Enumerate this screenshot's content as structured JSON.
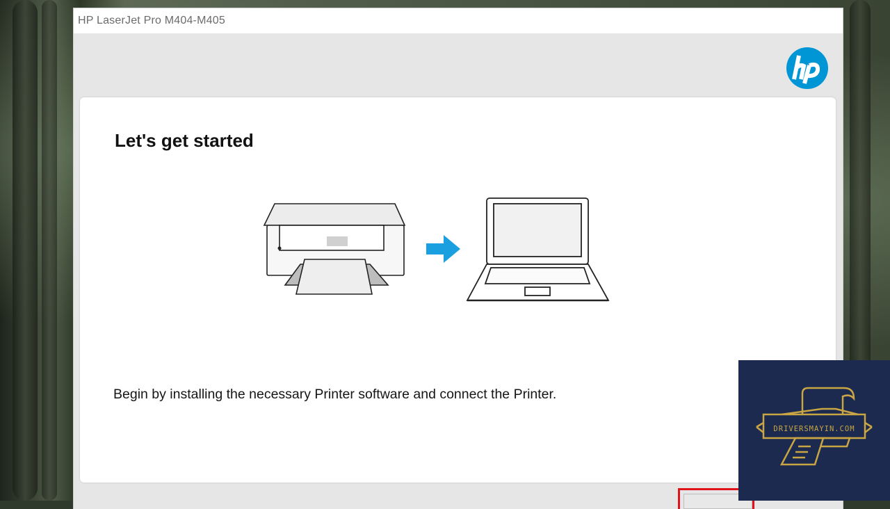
{
  "window": {
    "title": "HP LaserJet Pro M404-M405"
  },
  "brand": {
    "logo_icon": "hp-logo-icon",
    "accent_color": "#0096d6"
  },
  "content": {
    "heading": "Let's get started",
    "description": "Begin by installing the necessary Printer software and connect the Printer.",
    "illustration_icons": [
      "printer-icon",
      "arrow-right-icon",
      "laptop-icon"
    ]
  },
  "watermark": {
    "text": "DRIVERSMAYIN.COM",
    "background_color": "#1b2a4e",
    "accent_color": "#c9a544"
  },
  "highlight": {
    "color": "#e1141b"
  }
}
